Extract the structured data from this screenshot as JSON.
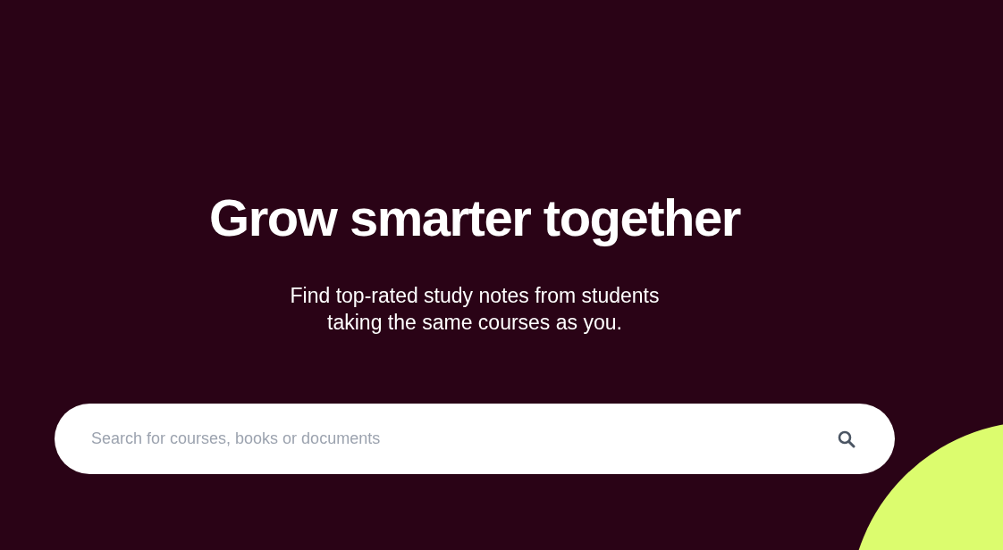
{
  "hero": {
    "title": "Grow smarter together",
    "subtitle_lines": [
      "Find top-rated study notes from students",
      "taking the same courses as you."
    ]
  },
  "search": {
    "placeholder": "Search for courses, books or documents"
  }
}
